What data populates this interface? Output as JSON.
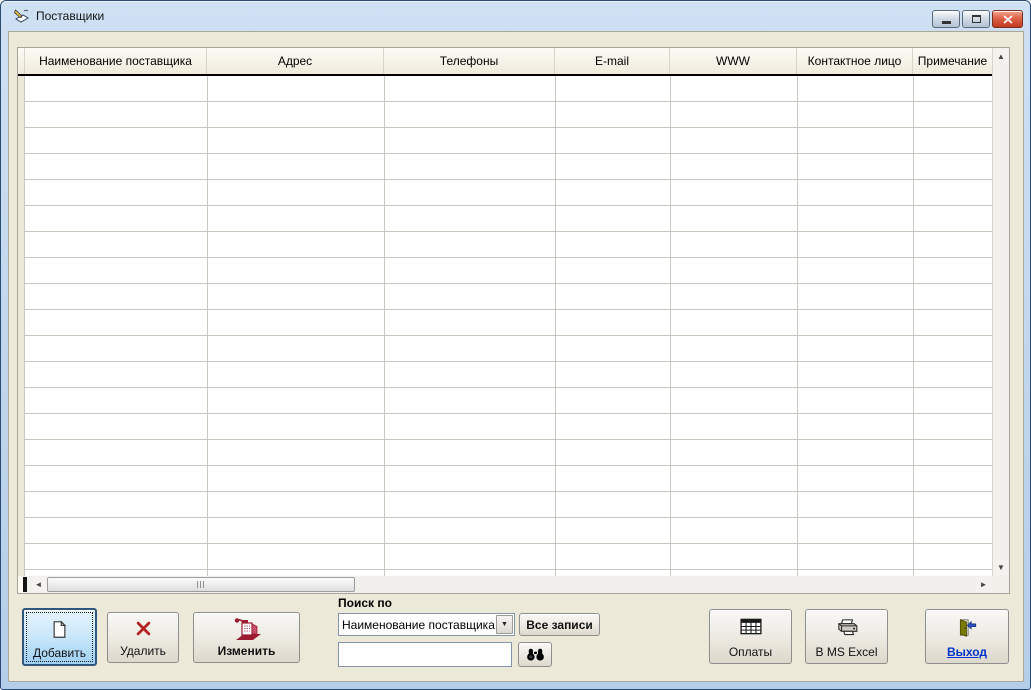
{
  "window": {
    "title": "Поставщики"
  },
  "table": {
    "columns": [
      "Наименование поставщика",
      "Адрес",
      "Телефоны",
      "E-mail",
      "WWW",
      "Контактное лицо",
      "Примечание"
    ],
    "rows": []
  },
  "buttons": {
    "add": "Добавить",
    "delete": "Удалить",
    "edit": "Изменить",
    "payments": "Оплаты",
    "excel": "В MS Excel",
    "exit": "Выход"
  },
  "search": {
    "label": "Поиск по",
    "field_selected": "Наименование поставщика",
    "all_records": "Все записи",
    "query": ""
  },
  "colors": {
    "titlebar": "#bfd4ec",
    "client_bg": "#ece9d8",
    "focus_button": "#9ed0f2",
    "exit_link": "#0033cc",
    "delete_x": "#b22424",
    "edit_icon": "#9b1b30",
    "grid_line": "#c9c6bd"
  }
}
